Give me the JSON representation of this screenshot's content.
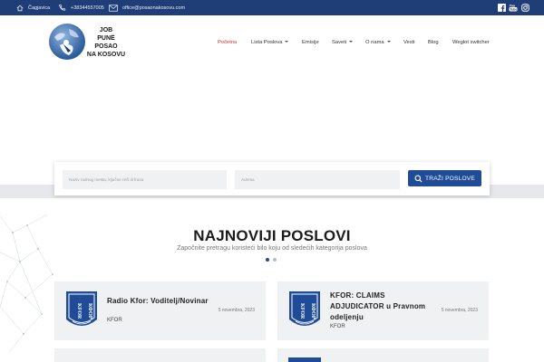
{
  "topbar": {
    "location": "Čagjavica",
    "phone": "+38344557005",
    "email": "office@posaonakosovu.com",
    "social": [
      "facebook-icon",
      "youtube-icon",
      "instagram-icon"
    ]
  },
  "logo": {
    "line1": "JOB",
    "line2": "PUNË",
    "line3": "POSAO",
    "line4": "NA KOSOVU"
  },
  "nav": {
    "items": [
      {
        "label": "Početna",
        "active": true,
        "dropdown": false
      },
      {
        "label": "Lista Poslova",
        "active": false,
        "dropdown": true
      },
      {
        "label": "Emisije",
        "active": false,
        "dropdown": false
      },
      {
        "label": "Saveti",
        "active": false,
        "dropdown": true
      },
      {
        "label": "O nama",
        "active": false,
        "dropdown": true
      },
      {
        "label": "Vesti",
        "active": false,
        "dropdown": false
      },
      {
        "label": "Blog",
        "active": false,
        "dropdown": false
      },
      {
        "label": "Weglot switcher",
        "active": false,
        "dropdown": false
      }
    ]
  },
  "search": {
    "keyword_placeholder": "Naziv radnog mesta, ključne reči ili fraza",
    "address_placeholder": "Adresa",
    "button_label": "TRAŽI POSLOVE"
  },
  "section": {
    "title": "NAJNOVIJI POSLOVI",
    "subtitle": "Započnite pretragu koristeći bilo koju od sledećih kategorija poslova"
  },
  "jobs": [
    {
      "title": "Radio Kfor: Voditelj/Novinar",
      "company": "KFOR",
      "date": "5 novembra, 2023"
    },
    {
      "title": "KFOR: CLAIMS ADJUDICATOR u Pravnom odeljenju",
      "company": "KFOR",
      "date": "5 novembra, 2023"
    }
  ],
  "colors": {
    "brand": "#1f3d76",
    "button": "#1f4b97",
    "active_nav": "#d0312d"
  }
}
